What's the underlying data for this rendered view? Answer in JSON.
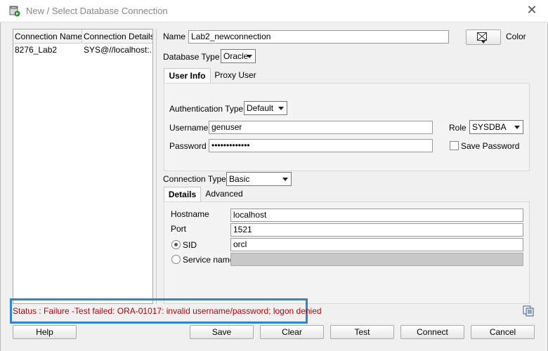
{
  "window": {
    "title": "New / Select Database Connection",
    "close_glyph": "✕"
  },
  "connections": {
    "headers": [
      "Connection Name",
      "Connection Details"
    ],
    "rows": [
      {
        "name": "8276_Lab2",
        "details": "SYS@//localhost:..."
      }
    ]
  },
  "form": {
    "name_label": "Name",
    "name_value": "Lab2_newconnection",
    "color_label": "Color",
    "db_type_label": "Database Type",
    "db_type_value": "Oracle",
    "tabs_top": [
      "User Info",
      "Proxy User"
    ],
    "auth_type_label": "Authentication Type",
    "auth_type_value": "Default",
    "username_label": "Username",
    "username_value": "genuser",
    "password_label": "Password",
    "password_value": "•••••••••••••",
    "role_label": "Role",
    "role_value": "SYSDBA",
    "save_password_label": "Save Password",
    "conn_type_label": "Connection Type",
    "conn_type_value": "Basic",
    "tabs_bottom": [
      "Details",
      "Advanced"
    ],
    "hostname_label": "Hostname",
    "hostname_value": "localhost",
    "port_label": "Port",
    "port_value": "1521",
    "sid_label": "SID",
    "sid_value": "orcl",
    "service_name_label": "Service name",
    "service_name_value": ""
  },
  "status": {
    "text": "Status : Failure -Test failed: ORA-01017: invalid username/password; logon denied",
    "color": "#c00000",
    "highlight_color": "#2f84d6"
  },
  "buttons": {
    "help": "Help",
    "save": "Save",
    "clear": "Clear",
    "test": "Test",
    "connect": "Connect",
    "cancel": "Cancel"
  },
  "icons": {
    "app": "sql-developer-connection-icon",
    "color_picker": "color-swatch-icon",
    "copy": "copy-icon"
  }
}
